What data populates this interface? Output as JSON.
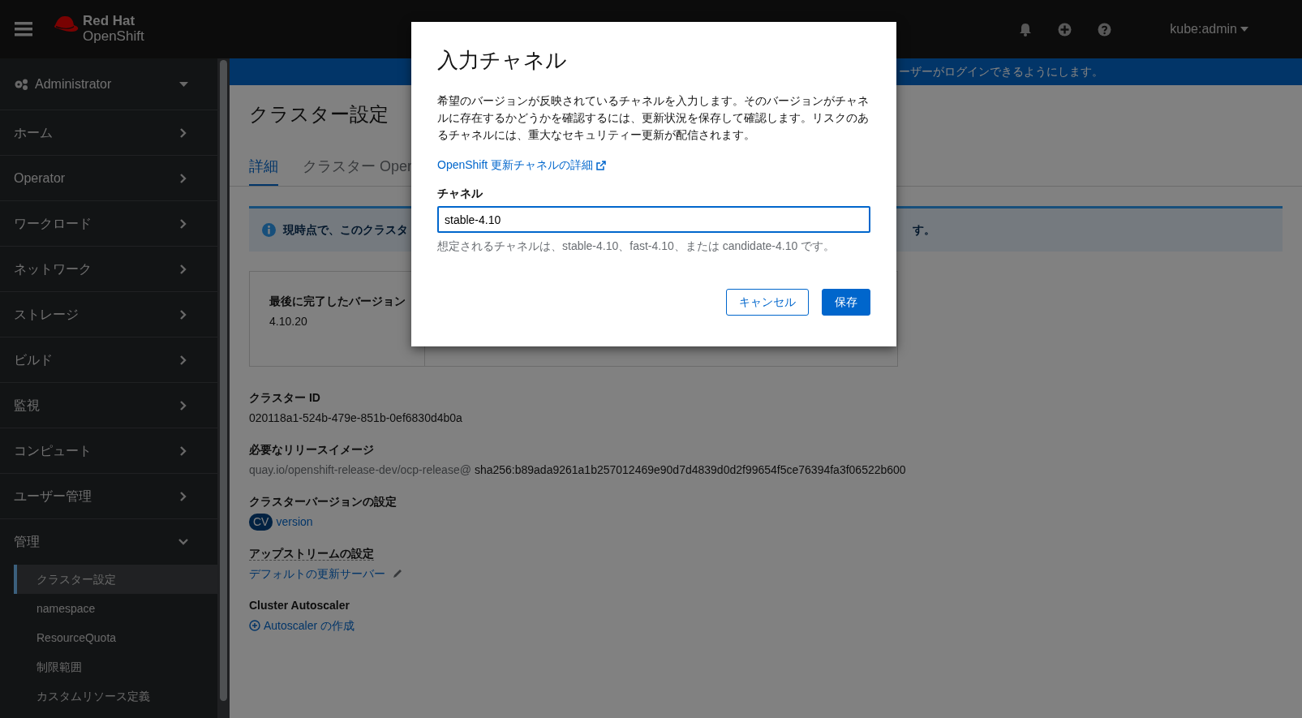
{
  "masthead": {
    "brand_top": "Red Hat",
    "brand_bottom": "OpenShift",
    "user": "kube:admin"
  },
  "perspective": {
    "label": "Administrator"
  },
  "nav": [
    {
      "label": "ホーム",
      "expanded": false
    },
    {
      "label": "Operator",
      "expanded": false
    },
    {
      "label": "ワークロード",
      "expanded": false
    },
    {
      "label": "ネットワーク",
      "expanded": false
    },
    {
      "label": "ストレージ",
      "expanded": false
    },
    {
      "label": "ビルド",
      "expanded": false
    },
    {
      "label": "監視",
      "expanded": false
    },
    {
      "label": "コンピュート",
      "expanded": false
    },
    {
      "label": "ユーザー管理",
      "expanded": false
    },
    {
      "label": "管理",
      "expanded": true,
      "children": [
        {
          "label": "クラスター設定",
          "selected": true
        },
        {
          "label": "namespace",
          "selected": false
        },
        {
          "label": "ResourceQuota",
          "selected": false
        },
        {
          "label": "制限範囲",
          "selected": false
        },
        {
          "label": "カスタムリソース定義",
          "selected": false
        }
      ]
    }
  ],
  "banner": {
    "text": "ーザーがログインできるようにします。"
  },
  "page": {
    "title": "クラスター設定",
    "tabs": [
      {
        "label": "詳細",
        "selected": true
      },
      {
        "label": "クラスター Oper",
        "selected": false
      }
    ],
    "alert": {
      "text_start": "現時点で、このクラスタ",
      "text_end": "す。"
    },
    "version_card": {
      "label": "最後に完了したバージョン",
      "value": "4.10.20"
    },
    "details": [
      {
        "kind": "text",
        "label": "クラスター ID",
        "value": "020118a1-524b-479e-851b-0ef6830d4b0a"
      },
      {
        "kind": "image",
        "label": "必要なリリースイメージ",
        "prefix": "quay.io/openshift-release-dev/ocp-release@",
        "value": "sha256:b89ada9261a1b257012469e90d7d4839d0d2f99654f5ce76394fa3f06522b600"
      },
      {
        "kind": "resource",
        "label": "クラスターバージョンの設定",
        "badge": "CV",
        "value": "version"
      },
      {
        "kind": "edit",
        "label": "アップストリームの設定",
        "value": "デフォルトの更新サーバー"
      },
      {
        "kind": "action",
        "label": "Cluster Autoscaler",
        "value": "Autoscaler の作成"
      }
    ]
  },
  "modal": {
    "title": "入力チャネル",
    "description": "希望のバージョンが反映されているチャネルを入力します。そのバージョンがチャネルに存在するかどうかを確認するには、更新状況を保存して確認します。リスクのあるチャネルには、重大なセキュリティー更新が配信されます。",
    "link": "OpenShift 更新チャネルの詳細",
    "field_label": "チャネル",
    "value": "stable-4.10",
    "helper": "想定されるチャネルは、stable-4.10、fast-4.10、または candidate-4.10 です。",
    "buttons": [
      {
        "label": "キャンセル",
        "kind": "secondary"
      },
      {
        "label": "保存",
        "kind": "primary"
      }
    ]
  }
}
